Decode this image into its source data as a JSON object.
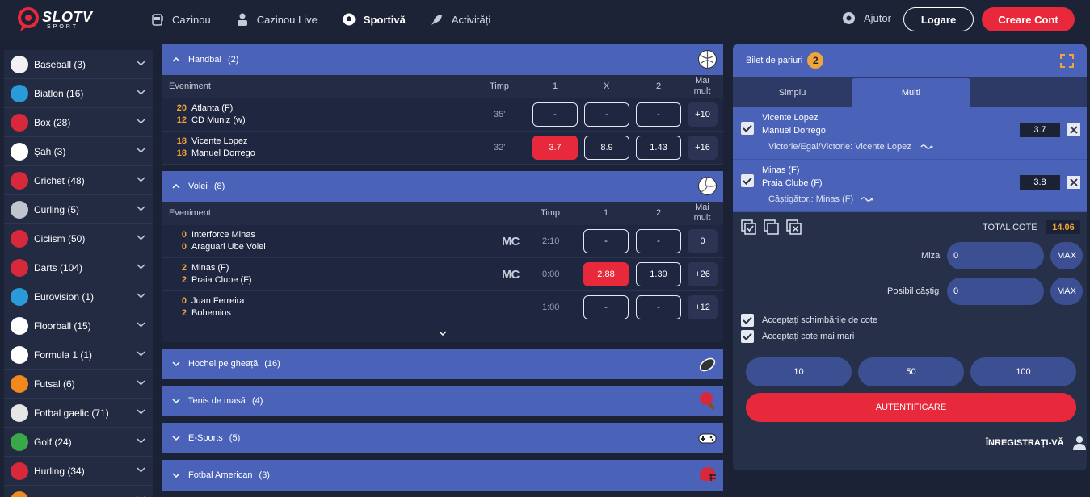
{
  "header": {
    "logo_main": "SLOTV",
    "logo_sub": "SPORT",
    "nav": [
      {
        "label": "Cazinou",
        "icon": "slot-machine-icon"
      },
      {
        "label": "Cazinou Live",
        "icon": "dealer-icon"
      },
      {
        "label": "Sportivă",
        "icon": "soccer-ball-icon"
      },
      {
        "label": "Activități",
        "icon": "rocket-icon"
      }
    ],
    "help": "Ajutor",
    "login": "Logare",
    "register": "Creare Cont"
  },
  "sidebar": {
    "items": [
      {
        "label": "Baseball (3)",
        "icon": "baseball-icon",
        "color": "#f2f2f2"
      },
      {
        "label": "Biatlon (16)",
        "icon": "biathlon-icon",
        "color": "#2a9ad8"
      },
      {
        "label": "Box (28)",
        "icon": "boxing-glove-icon",
        "color": "#d8283b"
      },
      {
        "label": "Șah (3)",
        "icon": "chess-rook-icon",
        "color": "#ffffff"
      },
      {
        "label": "Crichet (48)",
        "icon": "cricket-ball-icon",
        "color": "#d8283b"
      },
      {
        "label": "Curling (5)",
        "icon": "curling-stone-icon",
        "color": "#c0c4cf"
      },
      {
        "label": "Ciclism (50)",
        "icon": "bicycle-icon",
        "color": "#d8283b"
      },
      {
        "label": "Darts (104)",
        "icon": "dartboard-icon",
        "color": "#d8283b"
      },
      {
        "label": "Eurovision (1)",
        "icon": "heart-icon",
        "color": "#2a9ad8"
      },
      {
        "label": "Floorball (15)",
        "icon": "floorball-icon",
        "color": "#ffffff"
      },
      {
        "label": "Formula 1 (1)",
        "icon": "checkered-flag-icon",
        "color": "#ffffff"
      },
      {
        "label": "Futsal (6)",
        "icon": "futsal-ball-icon",
        "color": "#f08a1e"
      },
      {
        "label": "Fotbal gaelic (71)",
        "icon": "gaelic-ball-icon",
        "color": "#e6e6e6"
      },
      {
        "label": "Golf (24)",
        "icon": "golf-flag-icon",
        "color": "#3aa84a"
      },
      {
        "label": "Hurling (34)",
        "icon": "hurling-sticks-icon",
        "color": "#d8283b"
      },
      {
        "label": "",
        "icon": "sport-icon",
        "color": "#f08a1e"
      }
    ]
  },
  "sections": [
    {
      "title": "Handbal",
      "count": "(2)",
      "icon": "handball-icon",
      "expanded": true,
      "columns": {
        "event": "Eveniment",
        "time": "Timp",
        "c1": "1",
        "c2": "X",
        "c3": "2",
        "more": "Mai mult"
      },
      "rows": [
        {
          "s1": "20",
          "t1": "Atlanta (F)",
          "s2": "12",
          "t2": "CD Muniz (w)",
          "time": "35'",
          "o1": "-",
          "o2": "-",
          "o3": "-",
          "more": "+10",
          "sel": 0
        },
        {
          "s1": "18",
          "t1": "Vicente Lopez",
          "s2": "18",
          "t2": "Manuel Dorrego",
          "time": "32'",
          "o1": "3.7",
          "o2": "8.9",
          "o3": "1.43",
          "more": "+16",
          "sel": 1
        }
      ]
    },
    {
      "title": "Volei",
      "count": "(8)",
      "icon": "volleyball-icon",
      "expanded": true,
      "columns": {
        "event": "Eveniment",
        "time": "Timp",
        "c1": "1",
        "c2": "2",
        "more": "Mai mult"
      },
      "rows": [
        {
          "s1": "0",
          "t1": "Interforce Minas",
          "s2": "0",
          "t2": "Araguari Ube Volei",
          "mc": "MC",
          "time": "2:10",
          "o1": "-",
          "o2": "-",
          "more": "0",
          "sel": 0
        },
        {
          "s1": "2",
          "t1": "Minas (F)",
          "s2": "2",
          "t2": "Praia Clube (F)",
          "mc": "MC",
          "time": "0:00",
          "o1": "2.88",
          "o2": "1.39",
          "more": "+26",
          "sel": 1
        },
        {
          "s1": "0",
          "t1": "Juan Ferreira",
          "s2": "2",
          "t2": "Bohemios",
          "mc": "",
          "time": "1:00",
          "o1": "-",
          "o2": "-",
          "more": "+12",
          "sel": 0
        }
      ]
    },
    {
      "title": "Hochei pe gheață",
      "count": "(16)",
      "icon": "hockey-puck-icon"
    },
    {
      "title": "Tenis de masă",
      "count": "(4)",
      "icon": "table-tennis-icon"
    },
    {
      "title": "E-Sports",
      "count": "(5)",
      "icon": "gamepad-icon"
    },
    {
      "title": "Fotbal American",
      "count": "(3)",
      "icon": "football-helmet-icon"
    }
  ],
  "slip": {
    "title": "Bilet de pariuri",
    "badge": "2",
    "tabs": [
      "Simplu",
      "Multi"
    ],
    "active_tab": "Multi",
    "bets": [
      {
        "team1": "Vicente Lopez",
        "team2": "Manuel Dorrego",
        "odd": "3.7",
        "pick": "Victorie/Egal/Victorie: Vicente Lopez"
      },
      {
        "team1": "Minas (F)",
        "team2": "Praia Clube (F)",
        "odd": "3.8",
        "pick": "Câștigător.: Minas (F)"
      }
    ],
    "total_label": "TOTAL COTE",
    "total_value": "14.06",
    "stake_label": "Miza",
    "stake_value": "0",
    "win_label": "Posibil câștig",
    "win_value": "0",
    "max_label": "MAX",
    "accept1": "Acceptați schimbările de cote",
    "accept2": "Acceptați cote mai mari",
    "quick": [
      "10",
      "50",
      "100"
    ],
    "auth": "AUTENTIFICARE",
    "register": "ÎNREGISTRAȚI-VĂ"
  }
}
